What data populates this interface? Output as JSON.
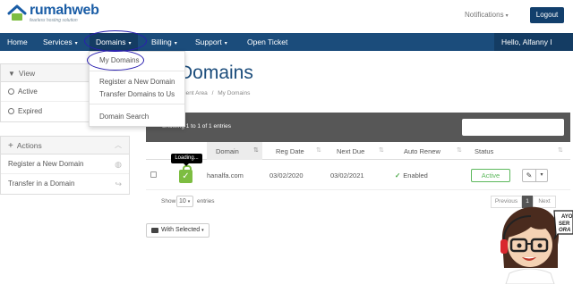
{
  "brand": {
    "name_part1": "rumah",
    "name_part2": "web",
    "tagline": "fearless hosting solution"
  },
  "header": {
    "notifications_label": "Notifications",
    "logout_label": "Logout"
  },
  "nav": {
    "items": [
      {
        "label": "Home"
      },
      {
        "label": "Services"
      },
      {
        "label": "Domains"
      },
      {
        "label": "Billing"
      },
      {
        "label": "Support"
      },
      {
        "label": "Open Ticket"
      }
    ],
    "user_greeting": "Hello, Alfanny I"
  },
  "dropdown": {
    "items": [
      {
        "label": "My Domains"
      },
      {
        "label": "Register a New Domain"
      },
      {
        "label": "Transfer Domains to Us"
      },
      {
        "label": "Domain Search"
      }
    ]
  },
  "sidebar": {
    "view_title": "View",
    "view_options": [
      {
        "label": "Active"
      },
      {
        "label": "Expired"
      }
    ],
    "actions_title": "Actions",
    "actions": [
      {
        "label": "Register a New Domain",
        "icon": "globe-icon"
      },
      {
        "label": "Transfer in a Domain",
        "icon": "share-arrow-icon"
      }
    ]
  },
  "page": {
    "title": "Domains",
    "breadcrumb": [
      "Client Area",
      "My Domains"
    ],
    "breadcrumb_sep": "/"
  },
  "table": {
    "info": "Showing 1 to 1 of 1 entries",
    "columns": [
      "Domain",
      "Reg Date",
      "Next Due",
      "Auto Renew",
      "Status"
    ],
    "rows": [
      {
        "domain": "hanalfa.com",
        "reg_date": "03/02/2020",
        "next_due": "03/02/2021",
        "auto_renew": "Enabled",
        "status": "Active"
      }
    ],
    "tooltip": "Loading...",
    "show_label": "Show",
    "show_value": "10",
    "entries_label": "entries",
    "pager": {
      "prev": "Previous",
      "current": "1",
      "next": "Next"
    }
  },
  "bulk": {
    "with_selected_label": "With Selected"
  },
  "mascot": {
    "speech_lines": [
      "AYO",
      "SER",
      "ORA"
    ]
  },
  "colors": {
    "brand_blue": "#1b4c7b",
    "active_green": "#5cb85c",
    "annotation": "#2a1fb0"
  }
}
